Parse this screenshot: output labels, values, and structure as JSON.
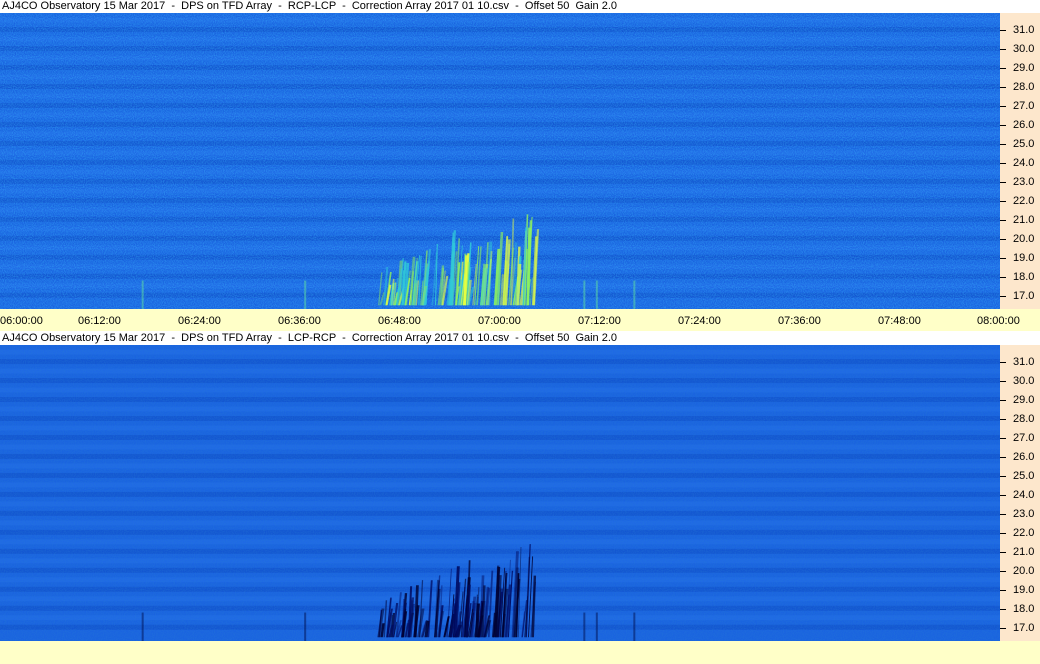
{
  "colors": {
    "axis_bg": "#fde7cc",
    "time_bar_bg": "#ffffc8",
    "spectrogram_base": "#1a63e0",
    "burst_bright": "#e6ff40",
    "burst_dark": "#000030"
  },
  "chart_data": [
    {
      "type": "heatmap",
      "title": "AJ4CO Observatory 15 Mar 2017  -  DPS on TFD Array  -  RCP-LCP  -  Correction Array 2017 01 10.csv  -  Offset 50  Gain 2.0",
      "x_ticks": [
        "06:00:00",
        "06:12:00",
        "06:24:00",
        "06:36:00",
        "06:48:00",
        "07:00:00",
        "07:12:00",
        "07:24:00",
        "07:36:00",
        "07:48:00",
        "08:00:00"
      ],
      "y_ticks": [
        "31.0",
        "30.0",
        "29.0",
        "28.0",
        "27.0",
        "26.0",
        "25.0",
        "24.0",
        "23.0",
        "22.0",
        "21.0",
        "20.0",
        "19.0",
        "18.0",
        "17.0"
      ],
      "xlim": [
        "06:00:00",
        "08:00:00"
      ],
      "ylim": [
        16.3,
        31.9
      ],
      "grid": false,
      "colormap": "blue-green-yellow",
      "bursts": [
        {
          "t_start": "06:45:00",
          "t_end": "06:56:00",
          "f_low": 16.5,
          "f_high": 21.0,
          "intensity": "bright"
        },
        {
          "t_start": "06:54:00",
          "t_end": "07:04:00",
          "f_low": 16.5,
          "f_high": 22.0,
          "intensity": "bright"
        }
      ]
    },
    {
      "type": "heatmap",
      "title": "AJ4CO Observatory 15 Mar 2017  -  DPS on TFD Array  -  LCP-RCP  -  Correction Array 2017 01 10.csv  -  Offset 50  Gain 2.0",
      "x_ticks": [],
      "y_ticks": [
        "31.0",
        "30.0",
        "29.0",
        "28.0",
        "27.0",
        "26.0",
        "25.0",
        "24.0",
        "23.0",
        "22.0",
        "21.0",
        "20.0",
        "19.0",
        "18.0",
        "17.0"
      ],
      "xlim": [
        "06:00:00",
        "08:00:00"
      ],
      "ylim": [
        16.3,
        31.9
      ],
      "grid": false,
      "colormap": "blue-black",
      "bursts": [
        {
          "t_start": "06:45:00",
          "t_end": "06:56:00",
          "f_low": 16.5,
          "f_high": 21.0,
          "intensity": "dark"
        },
        {
          "t_start": "06:54:00",
          "t_end": "07:04:00",
          "f_low": 16.5,
          "f_high": 22.0,
          "intensity": "dark"
        }
      ]
    }
  ]
}
